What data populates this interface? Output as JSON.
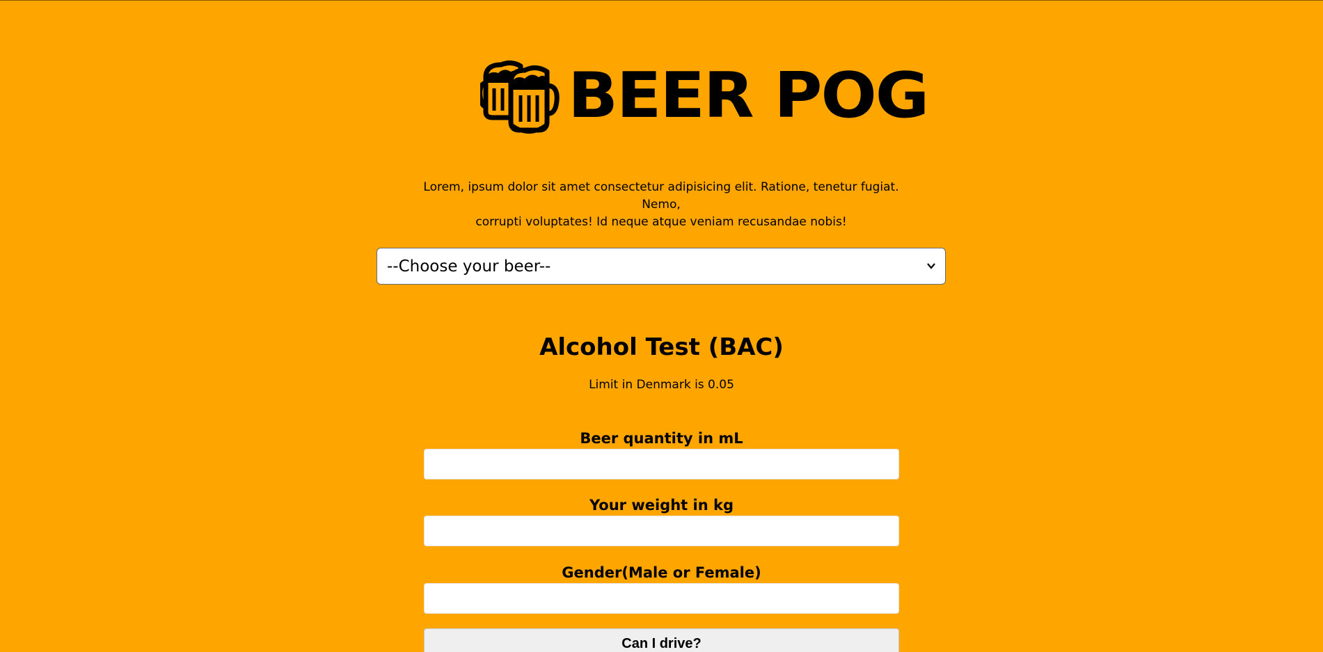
{
  "brand": {
    "logo_icon": "beer-mugs-icon",
    "name": "BEER POG"
  },
  "intro": {
    "line1": "Lorem, ipsum dolor sit amet consectetur adipisicing elit. Ratione, tenetur fugiat. Nemo,",
    "line2": "corrupti voluptates! Id neque atque veniam recusandae nobis!"
  },
  "beer_select": {
    "selected": "--Choose your beer--",
    "icon": "chevron-down-icon"
  },
  "bac_test": {
    "title": "Alcohol Test (BAC)",
    "limit_text": "Limit in Denmark is 0.05",
    "fields": [
      {
        "label": "Beer quantity in mL",
        "value": ""
      },
      {
        "label": "Your weight in kg",
        "value": ""
      },
      {
        "label": "Gender(Male or Female)",
        "value": ""
      }
    ],
    "submit_label": "Can I drive?"
  },
  "colors": {
    "background": "#FFA500",
    "text": "#000000",
    "input_bg": "#FFFFFF",
    "button_bg": "#EFEFEF"
  }
}
